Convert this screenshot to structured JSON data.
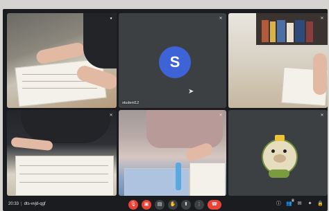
{
  "tiles": [
    {
      "id": "t1",
      "name": "",
      "mic_icon": "mic-icon"
    },
    {
      "id": "t2",
      "name": "student12",
      "avatar_letter": "S",
      "avatar_color": "#3e63d6",
      "mic_icon": "mic-off-icon"
    },
    {
      "id": "t3",
      "name": "",
      "mic_icon": "mic-off-icon"
    },
    {
      "id": "t4",
      "name": "",
      "mic_icon": "mic-off-icon"
    },
    {
      "id": "t5",
      "name": "",
      "mic_icon": "mic-off-icon"
    },
    {
      "id": "t6",
      "name": "",
      "mic_icon": "mic-off-icon"
    }
  ],
  "bottom_bar": {
    "time": "20:33",
    "meeting_code": "dts-vvjd-qgf"
  },
  "controls": [
    {
      "name": "mic-toggle",
      "icon": "mic-off-icon",
      "glyph": "🎙",
      "state": "off"
    },
    {
      "name": "camera-toggle",
      "icon": "camera-off-icon",
      "glyph": "▣",
      "state": "off"
    },
    {
      "name": "captions",
      "icon": "captions-icon",
      "glyph": "▤"
    },
    {
      "name": "raise-hand",
      "icon": "hand-icon",
      "glyph": "✋"
    },
    {
      "name": "present",
      "icon": "present-icon",
      "glyph": "⬆"
    },
    {
      "name": "more-options",
      "icon": "more-icon",
      "glyph": "⋮"
    },
    {
      "name": "leave-call",
      "icon": "phone-hangup-icon",
      "glyph": "☎"
    }
  ],
  "right_controls": [
    {
      "name": "info",
      "icon": "info-icon",
      "glyph": "ⓘ"
    },
    {
      "name": "people",
      "icon": "people-icon",
      "glyph": "👥",
      "count": "6"
    },
    {
      "name": "chat",
      "icon": "chat-icon",
      "glyph": "✉"
    },
    {
      "name": "activities",
      "icon": "activities-icon",
      "glyph": "✦"
    },
    {
      "name": "host-controls",
      "icon": "lock-icon",
      "glyph": "🔒"
    }
  ],
  "colors": {
    "accent_red": "#ea4335",
    "avatar_blue": "#3e63d6",
    "tile_bg": "#3c4043"
  }
}
